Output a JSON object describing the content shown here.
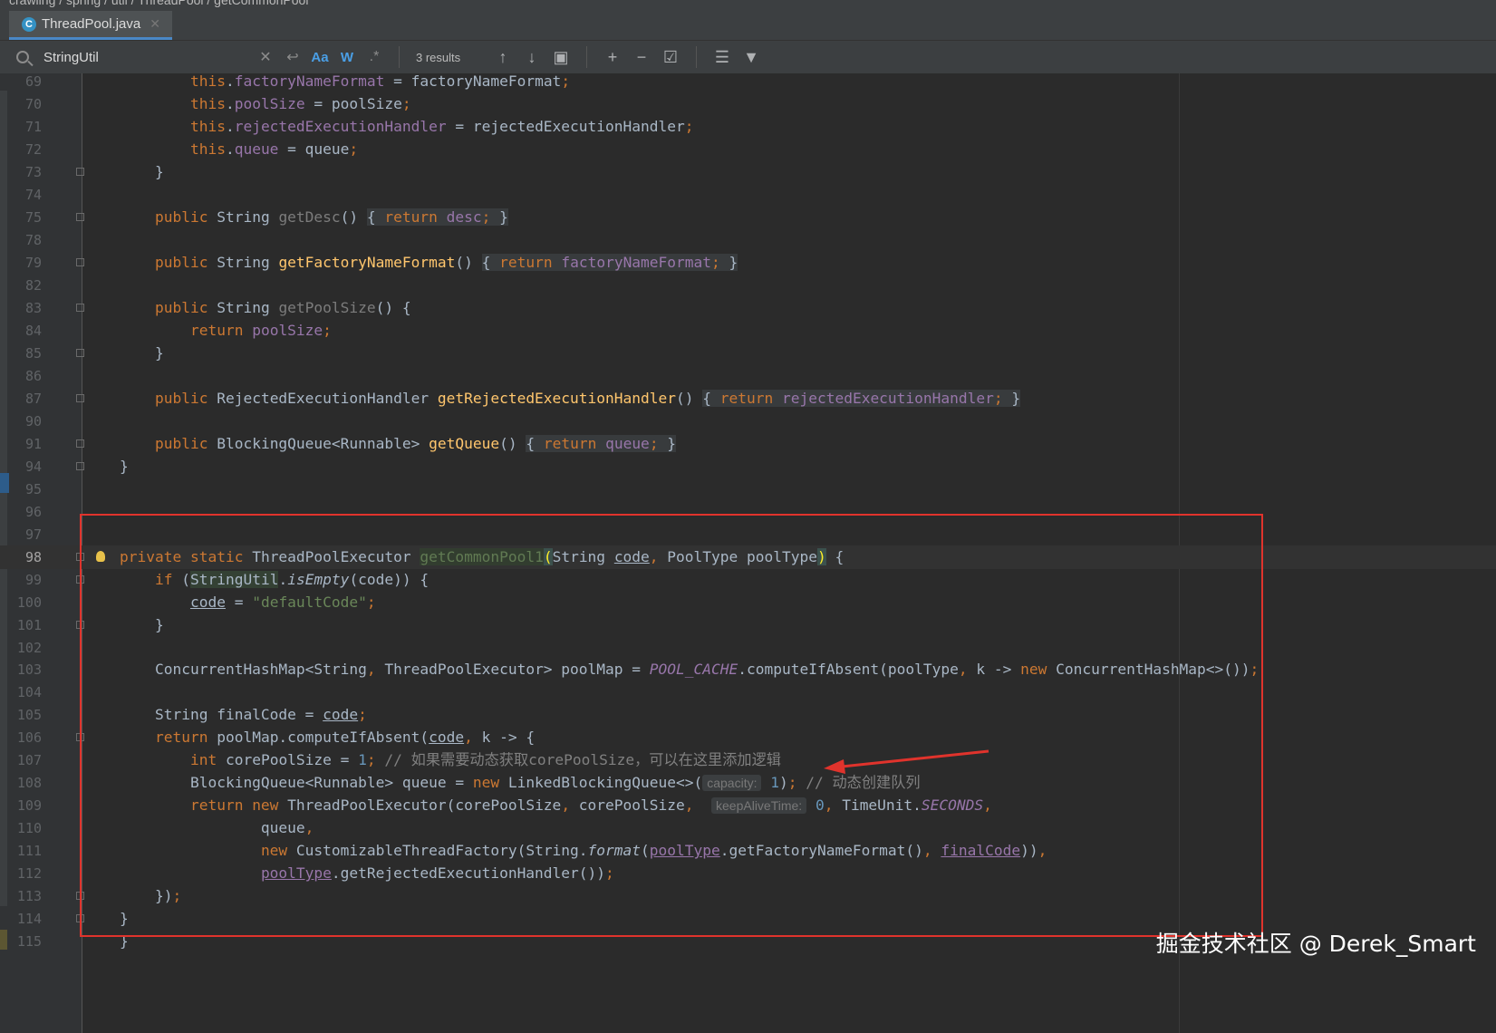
{
  "breadcrumb": [
    "crawling",
    "spring",
    "util",
    "ThreadPool",
    "getCommonPool"
  ],
  "tab": {
    "icon": "C",
    "filename": "ThreadPool.java"
  },
  "find": {
    "query": "StringUtil",
    "results": "3 results",
    "match_case": "Aa",
    "words": "W"
  },
  "watermark": "掘金技术社区 @ Derek_Smart",
  "highlight_color": "#e0332c",
  "lines": [
    {
      "n": "69",
      "html": "        <span class='kw'>this</span>.<span class='fld'>factoryNameFormat</span> = factoryNameFormat<span class='kw'>;</span>"
    },
    {
      "n": "70",
      "html": "        <span class='kw'>this</span>.<span class='fld'>poolSize</span> = poolSize<span class='kw'>;</span>"
    },
    {
      "n": "71",
      "html": "        <span class='kw'>this</span>.<span class='fld'>rejectedExecutionHandler</span> = rejectedExecutionHandler<span class='kw'>;</span>"
    },
    {
      "n": "72",
      "html": "        <span class='kw'>this</span>.<span class='fld'>queue</span> = queue<span class='kw'>;</span>"
    },
    {
      "n": "73",
      "html": "    }",
      "fold": true
    },
    {
      "n": "74",
      "html": ""
    },
    {
      "n": "75",
      "html": "    <span class='kw'>public</span> String <span class='gf'>getDesc</span>() <span class='fh'>{ <span class='kw'>return</span> <span class='fld'>desc</span><span class='kw'>;</span> }</span>",
      "fold": true
    },
    {
      "n": "78",
      "html": ""
    },
    {
      "n": "79",
      "html": "    <span class='kw'>public</span> String <span class='fn'>getFactoryNameFormat</span>() <span class='fh'>{ <span class='kw'>return</span> <span class='fld'>factoryNameFormat</span><span class='kw'>;</span> }</span>",
      "fold": true
    },
    {
      "n": "82",
      "html": ""
    },
    {
      "n": "83",
      "html": "    <span class='kw'>public</span> String <span class='gf'>getPoolSize</span>() {",
      "fold": true
    },
    {
      "n": "84",
      "html": "        <span class='kw'>return</span> <span class='fld'>poolSize</span><span class='kw'>;</span>"
    },
    {
      "n": "85",
      "html": "    }",
      "fold": true
    },
    {
      "n": "86",
      "html": ""
    },
    {
      "n": "87",
      "html": "    <span class='kw'>public</span> RejectedExecutionHandler <span class='fn'>getRejectedExecutionHandler</span>() <span class='fh'>{ <span class='kw'>return</span> <span class='fld'>rejectedExecutionHandler</span><span class='kw'>;</span> }</span>",
      "fold": true
    },
    {
      "n": "90",
      "html": ""
    },
    {
      "n": "91",
      "html": "    <span class='kw'>public</span> BlockingQueue&lt;Runnable&gt; <span class='fn'>getQueue</span>() <span class='fh'>{ <span class='kw'>return</span> <span class='fld'>queue</span><span class='kw'>;</span> }</span>",
      "fold": true
    },
    {
      "n": "94",
      "html": "}",
      "fold": true
    },
    {
      "n": "95",
      "html": ""
    },
    {
      "n": "96",
      "html": ""
    },
    {
      "n": "97",
      "html": ""
    },
    {
      "n": "98",
      "html": "<span class='kw'>private static</span> ThreadPoolExecutor <span class='unused'>getCommonPool1</span><span class='brk'>(</span>String <span class='u'>code</span><span class='kw'>,</span> PoolType poolType<span class='brk'>)</span> {",
      "fold": true,
      "cur": true,
      "bulb": true
    },
    {
      "n": "99",
      "html": "    <span class='kw'>if</span> (<span class='hl'>StringUtil</span>.<span class='it'>isEmpty</span>(code)) {",
      "fold": true
    },
    {
      "n": "100",
      "html": "        <span class='u'>code</span> = <span class='str'>\"defaultCode\"</span><span class='kw'>;</span>"
    },
    {
      "n": "101",
      "html": "    }",
      "fold": true
    },
    {
      "n": "102",
      "html": ""
    },
    {
      "n": "103",
      "html": "    ConcurrentHashMap&lt;String<span class='kw'>,</span> ThreadPoolExecutor&gt; poolMap = <span class='st'>POOL_CACHE</span>.computeIfAbsent(poolType<span class='kw'>,</span> k -&gt; <span class='kw'>new</span> ConcurrentHashMap&lt;&gt;())<span class='kw'>;</span>"
    },
    {
      "n": "104",
      "html": ""
    },
    {
      "n": "105",
      "html": "    String finalCode = <span class='u'>code</span><span class='kw'>;</span>"
    },
    {
      "n": "106",
      "html": "    <span class='kw'>return</span> poolMap.computeIfAbsent(<span class='u'>code</span><span class='kw'>,</span> k -&gt; {",
      "fold": true
    },
    {
      "n": "107",
      "html": "        <span class='kw'>int</span> corePoolSize = <span class='num'>1</span><span class='kw'>;</span> <span class='cm'>// 如果需要动态获取corePoolSize，可以在这里添加逻辑</span>"
    },
    {
      "n": "108",
      "html": "        BlockingQueue&lt;Runnable&gt; queue = <span class='kw'>new</span> LinkedBlockingQueue&lt;&gt;(<span class='hint'>capacity:</span> <span class='num'>1</span>)<span class='kw'>;</span> <span class='cm'>// 动态创建队列</span>"
    },
    {
      "n": "109",
      "html": "        <span class='kw'>return new</span> ThreadPoolExecutor(corePoolSize<span class='kw'>,</span> corePoolSize<span class='kw'>,</span>  <span class='hint'>keepAliveTime:</span> <span class='num'>0</span><span class='kw'>,</span> TimeUnit.<span class='st'>SECONDS</span><span class='kw'>,</span>"
    },
    {
      "n": "110",
      "html": "                queue<span class='kw'>,</span>"
    },
    {
      "n": "111",
      "html": "                <span class='kw'>new</span> CustomizableThreadFactory(String.<span class='it'>format</span>(<span class='fld u'>poolType</span>.getFactoryNameFormat()<span class='kw'>,</span> <span class='fld u'>finalCode</span>))<span class='kw'>,</span>"
    },
    {
      "n": "112",
      "html": "                <span class='fld u'>poolType</span>.getRejectedExecutionHandler())<span class='kw'>;</span>"
    },
    {
      "n": "113",
      "html": "    })<span class='kw'>;</span>",
      "fold": true
    },
    {
      "n": "114",
      "html": "}",
      "fold": true
    },
    {
      "n": "115",
      "html": "}"
    }
  ]
}
